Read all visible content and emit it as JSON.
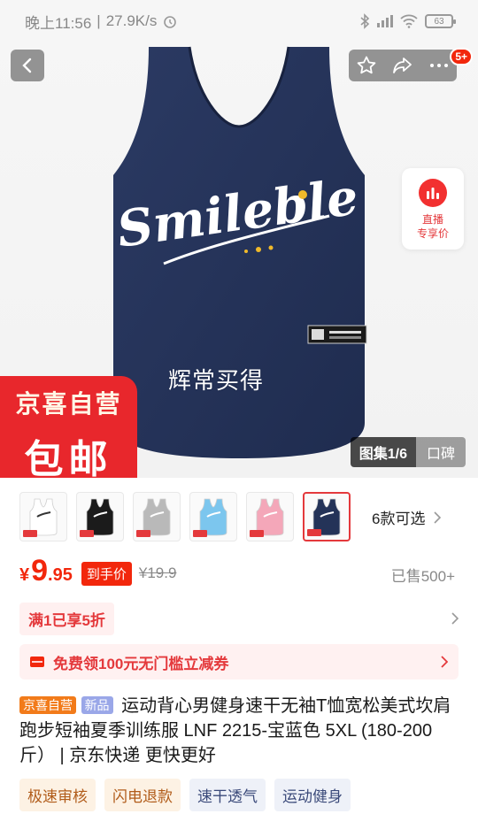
{
  "status_bar": {
    "time": "晚上11:56",
    "net_speed": "27.9K/s",
    "battery": "63"
  },
  "nav": {
    "badge_count": "5+"
  },
  "hero": {
    "overlay_text": "辉常买得",
    "product_print": "Smileble",
    "live_card": {
      "line1": "直播",
      "line2": "专享价"
    },
    "promo_badge": {
      "top": "京喜自营",
      "main": "包邮"
    },
    "gallery": {
      "current": "图集1/6",
      "reviews": "口碑"
    }
  },
  "variants": {
    "thumbnails": [
      {
        "color": "#ffffff",
        "print": "#333333"
      },
      {
        "color": "#1b1b1b",
        "print": "#ffffff"
      },
      {
        "color": "#b9b9b9",
        "print": "#ffffff"
      },
      {
        "color": "#7cc6ee",
        "print": "#ffffff"
      },
      {
        "color": "#f4a7b9",
        "print": "#ffffff"
      },
      {
        "color": "#243358",
        "print": "#ffffff"
      }
    ],
    "count_label": "6款可选"
  },
  "price": {
    "currency": "¥",
    "integer": "9",
    "decimal": ".95",
    "tag": "到手价",
    "original": "¥19.9",
    "sold": "已售500+"
  },
  "promotion": {
    "discount": "满1已享5折"
  },
  "coupon": {
    "text": "免费领100元无门槛立减券"
  },
  "product": {
    "badge_jd": "京喜自营",
    "badge_new": "新品",
    "title": "运动背心男健身速干无袖T恤宽松美式坎肩跑步短袖夏季训练服 LNF 2215-宝蓝色 5XL (180-200斤） | 京东快递 更快更好"
  },
  "feature_tags": [
    "极速审核",
    "闪电退款",
    "速干透气",
    "运动健身"
  ],
  "colors": {
    "accent": "#f2270c",
    "navy": "#243358"
  }
}
